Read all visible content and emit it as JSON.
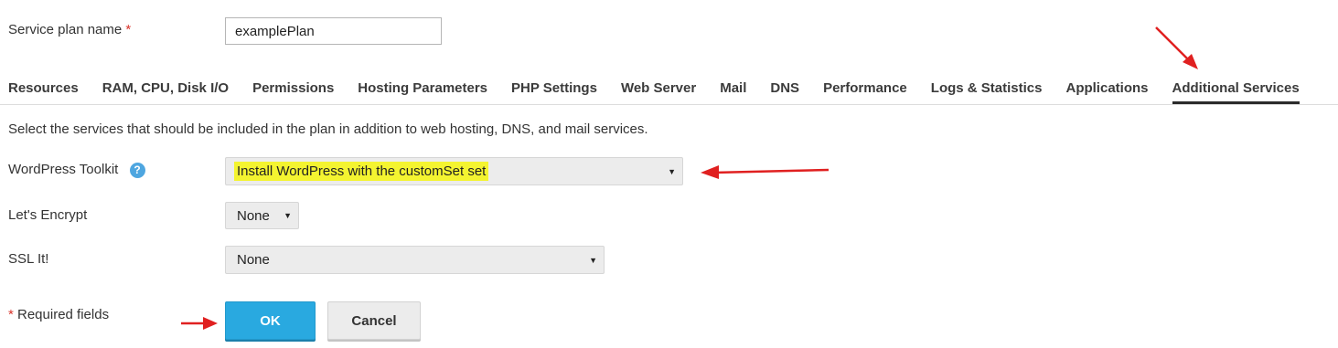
{
  "plan_name": {
    "label": "Service plan name",
    "required_marker": "*",
    "value": "examplePlan"
  },
  "tabs": [
    {
      "label": "Resources",
      "active": false
    },
    {
      "label": "RAM, CPU, Disk I/O",
      "active": false
    },
    {
      "label": "Permissions",
      "active": false
    },
    {
      "label": "Hosting Parameters",
      "active": false
    },
    {
      "label": "PHP Settings",
      "active": false
    },
    {
      "label": "Web Server",
      "active": false
    },
    {
      "label": "Mail",
      "active": false
    },
    {
      "label": "DNS",
      "active": false
    },
    {
      "label": "Performance",
      "active": false
    },
    {
      "label": "Logs & Statistics",
      "active": false
    },
    {
      "label": "Applications",
      "active": false
    },
    {
      "label": "Additional Services",
      "active": true
    }
  ],
  "intro": "Select the services that should be included in the plan in addition to web hosting, DNS, and mail services.",
  "fields": {
    "wordpress": {
      "label": "WordPress Toolkit",
      "help_icon": "?",
      "selected": "Install WordPress with the customSet set",
      "arrow": "▼"
    },
    "letsencrypt": {
      "label": "Let's Encrypt",
      "selected": "None",
      "arrow": "▼"
    },
    "sslit": {
      "label": "SSL It!",
      "selected": "None",
      "arrow": "▼"
    }
  },
  "footer": {
    "required_marker": "*",
    "required_text": " Required fields",
    "ok_label": "OK",
    "cancel_label": "Cancel"
  },
  "colors": {
    "annotation_arrow": "#e02020",
    "highlight": "#f4f430",
    "ok_button": "#29a9e0"
  }
}
